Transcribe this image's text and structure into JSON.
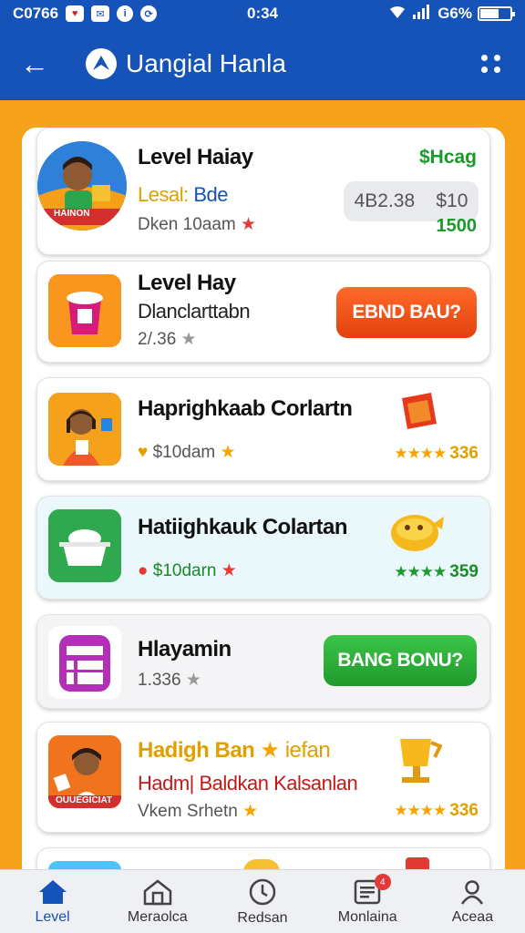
{
  "status_bar": {
    "left_text": "C0766",
    "time": "0:34",
    "battery": "G6%",
    "battery_level": 0.6
  },
  "app_bar": {
    "title": "Uangial Hanla"
  },
  "cards": [
    {
      "title": "Level Haiay",
      "subtitle_prefix": "Lesal:",
      "subtitle_value": "Bde",
      "meta": "Dken 10aam",
      "header_label": "$Hcag",
      "price_box": "4B2.38",
      "price_value": "$10",
      "price_total": "1500",
      "thumb_badge": "HAINON"
    },
    {
      "title": "Level Hay",
      "subtitle": "Dlanclarttabn",
      "meta": "2/.36",
      "button": "EBND BAU?"
    },
    {
      "title": "Haprighkaab Corlartn",
      "meta": "$10dam",
      "rating": "336"
    },
    {
      "title": "Hatiighkauk Colartan",
      "meta": "$10darn",
      "rating": "359"
    },
    {
      "title": "Hlayamin",
      "meta": "1.336",
      "button": "BANG BONU?"
    },
    {
      "title_prefix": "Hadigh Ban",
      "title_suffix": "iefan",
      "subtitle": "Hadm| Baldkan Kalsanlan",
      "meta": "Vkem Srhetn",
      "rating": "336",
      "thumb_badge": "OUUEGICIAT"
    }
  ],
  "bottom_nav": [
    {
      "label": "Level",
      "icon": "home-icon",
      "active": true
    },
    {
      "label": "Meraolca",
      "icon": "store-icon"
    },
    {
      "label": "Redsan",
      "icon": "clock-icon"
    },
    {
      "label": "Monlaina",
      "icon": "news-icon",
      "badge": "4"
    },
    {
      "label": "Aceaa",
      "icon": "user-icon"
    }
  ],
  "colors": {
    "primary": "#1553b8",
    "background": "#f7a21b",
    "cta_red": "#e2410e",
    "cta_green": "#1f9a2b",
    "price_green": "#1a9a2a"
  }
}
